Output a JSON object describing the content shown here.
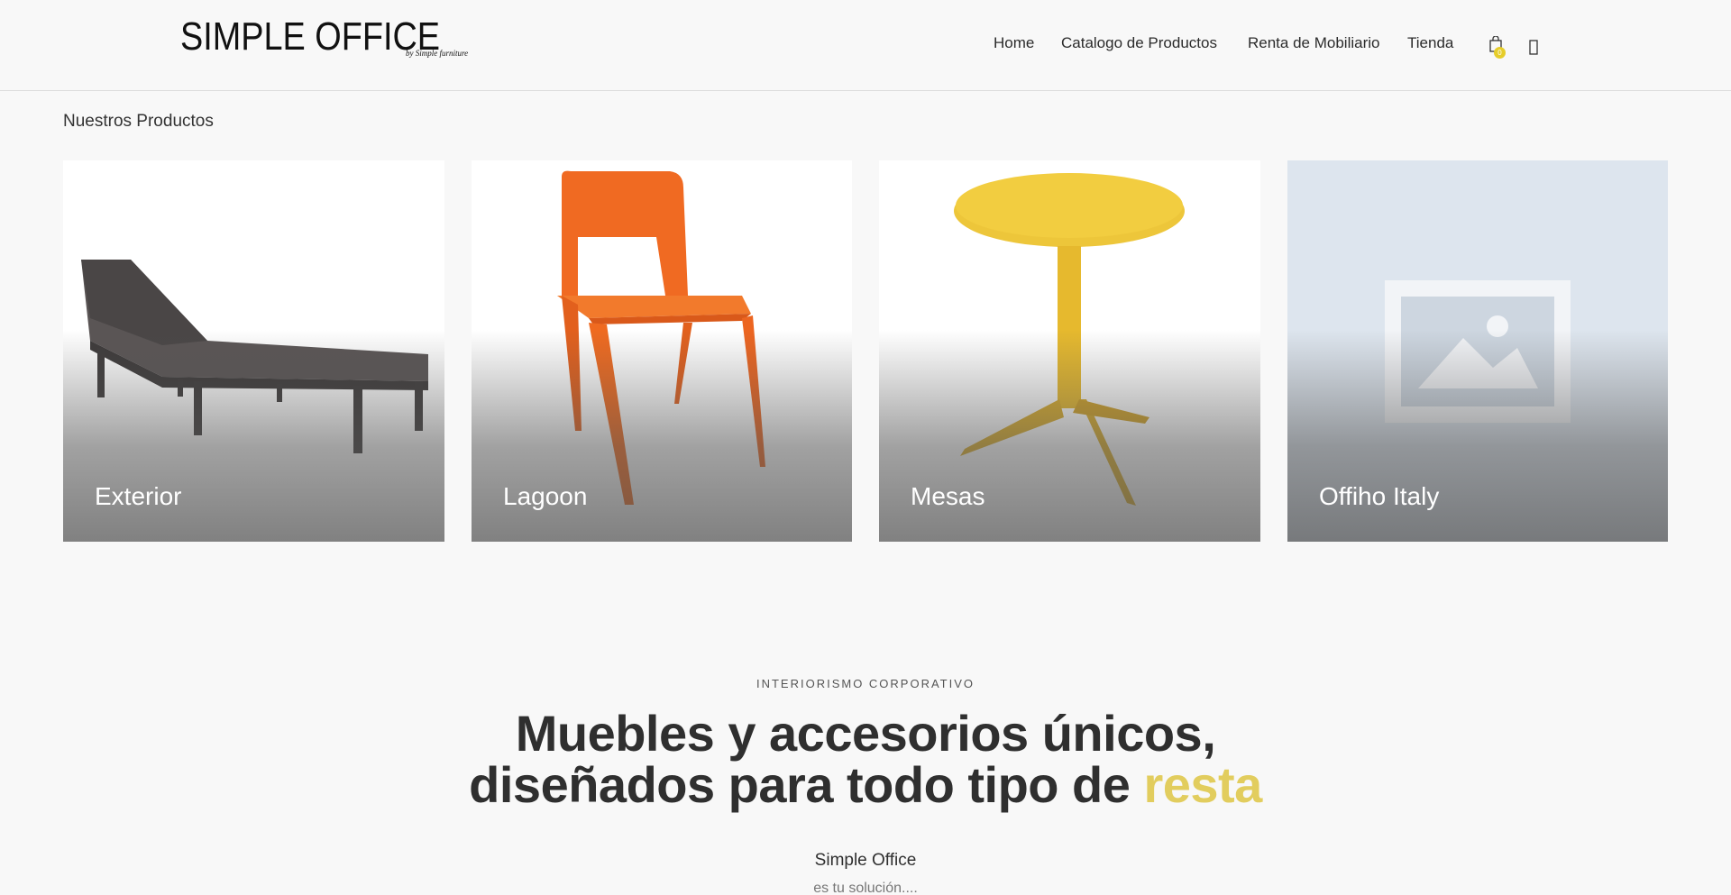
{
  "header": {
    "logo_text": "SIMPLE OFFICE",
    "logo_sub": "by Simple furniture",
    "nav": [
      {
        "label": "Home"
      },
      {
        "label": "Catalogo de Productos"
      },
      {
        "label": "Renta de Mobiliario"
      },
      {
        "label": "Tienda"
      }
    ],
    "cart_count": "0",
    "icons": [
      "cart-icon",
      "user-icon"
    ]
  },
  "products": {
    "title": "Nuestros Productos",
    "items": [
      {
        "label": "Exterior",
        "image": "lounge-chair"
      },
      {
        "label": "Lagoon",
        "image": "orange-chair"
      },
      {
        "label": "Mesas",
        "image": "yellow-table"
      },
      {
        "label": "Offiho Italy",
        "image": "placeholder-image"
      }
    ]
  },
  "intro": {
    "eyebrow": "INTERIORISMO CORPORATIVO",
    "headline_line1": "Muebles y accesorios únicos,",
    "headline_line2": "diseñados para todo tipo de ",
    "headline_accent": "resta",
    "sub_title": "Simple Office",
    "sub_text": "es tu solución...."
  },
  "colors": {
    "accent": "#e2cd5e",
    "badge": "#e6cd2a",
    "background": "#f8f8f8"
  }
}
